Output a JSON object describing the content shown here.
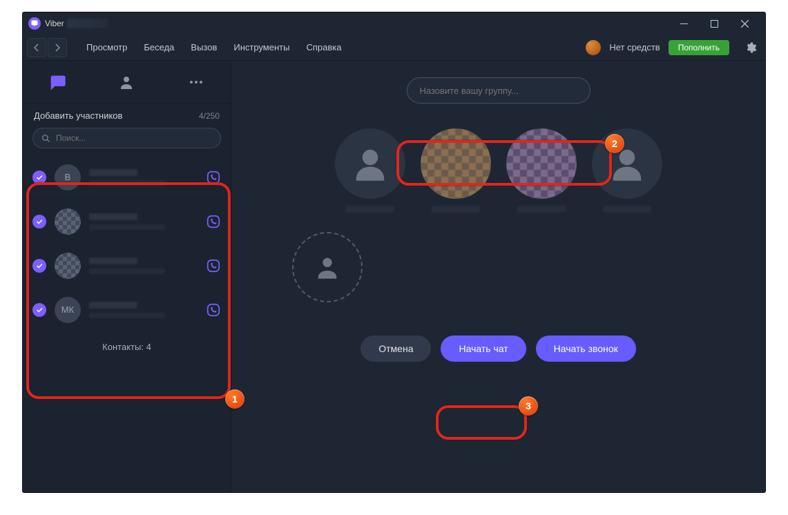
{
  "window": {
    "title": "Viber"
  },
  "menubar": {
    "items": [
      "Просмотр",
      "Беседа",
      "Вызов",
      "Инструменты",
      "Справка"
    ],
    "balance_label": "Нет средств",
    "topup_label": "Пополнить"
  },
  "sidebar": {
    "header_title": "Добавить участников",
    "count_label": "4/250",
    "search_placeholder": "Поиск...",
    "contacts": [
      {
        "initials": "В",
        "kind": "letter"
      },
      {
        "initials": "",
        "kind": "photo"
      },
      {
        "initials": "",
        "kind": "photo"
      },
      {
        "initials": "МК",
        "kind": "letter"
      }
    ],
    "footer_label": "Контакты: 4"
  },
  "main": {
    "group_name_placeholder": "Назовите вашу группу...",
    "participant_tiles": [
      {
        "kind": "placeholder"
      },
      {
        "kind": "photo"
      },
      {
        "kind": "photo"
      },
      {
        "kind": "placeholder"
      }
    ],
    "actions": {
      "cancel": "Отмена",
      "start_chat": "Начать чат",
      "start_call": "Начать звонок"
    }
  },
  "annotations": {
    "1": "1",
    "2": "2",
    "3": "3"
  }
}
